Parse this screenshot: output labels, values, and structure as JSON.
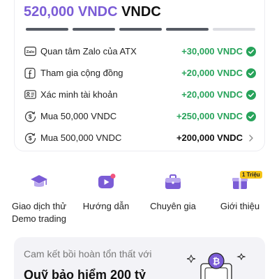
{
  "reward": {
    "amount": "520,000 VNDC",
    "currency": "VNDC",
    "progress_steps_done": 4,
    "progress_steps_total": 5,
    "tasks": [
      {
        "label": "Quan tâm Zalo của ATX",
        "value": "+30,000 VNDC",
        "icon": "zalo-icon",
        "done": true
      },
      {
        "label": "Tham gia cộng đồng",
        "value": "+20,000 VNDC",
        "icon": "facebook-icon",
        "done": true
      },
      {
        "label": "Xác minh tài khoản",
        "value": "+20,000 VNDC",
        "icon": "id-card-icon",
        "done": true
      },
      {
        "label": "Mua 50,000 VNDC",
        "value": "+250,000 VNDC",
        "icon": "dollar-cycle-icon",
        "done": true
      },
      {
        "label": "Mua 500,000 VNDC",
        "value": "+200,000 VNDC",
        "icon": "dollar-cycle-icon",
        "done": false
      }
    ],
    "zalo_icon_text": "Zalo",
    "accent_color": "#7b5cd6",
    "success_color": "#27a35a"
  },
  "features": [
    {
      "label": "Giao dịch thử",
      "label2": "Demo trading",
      "icon": "graduation-cap-icon"
    },
    {
      "label": "Hướng dẫn",
      "icon": "video-guide-icon"
    },
    {
      "label": "Chuyên gia",
      "icon": "briefcase-icon"
    },
    {
      "label": "Giới thiệu",
      "icon": "gift-icon",
      "badge": "1 Triệu"
    }
  ],
  "insurance": {
    "subtitle": "Cam kết bồi hoàn tổn thất với",
    "title": "Quỹ bảo hiểm 200 tỷ"
  }
}
